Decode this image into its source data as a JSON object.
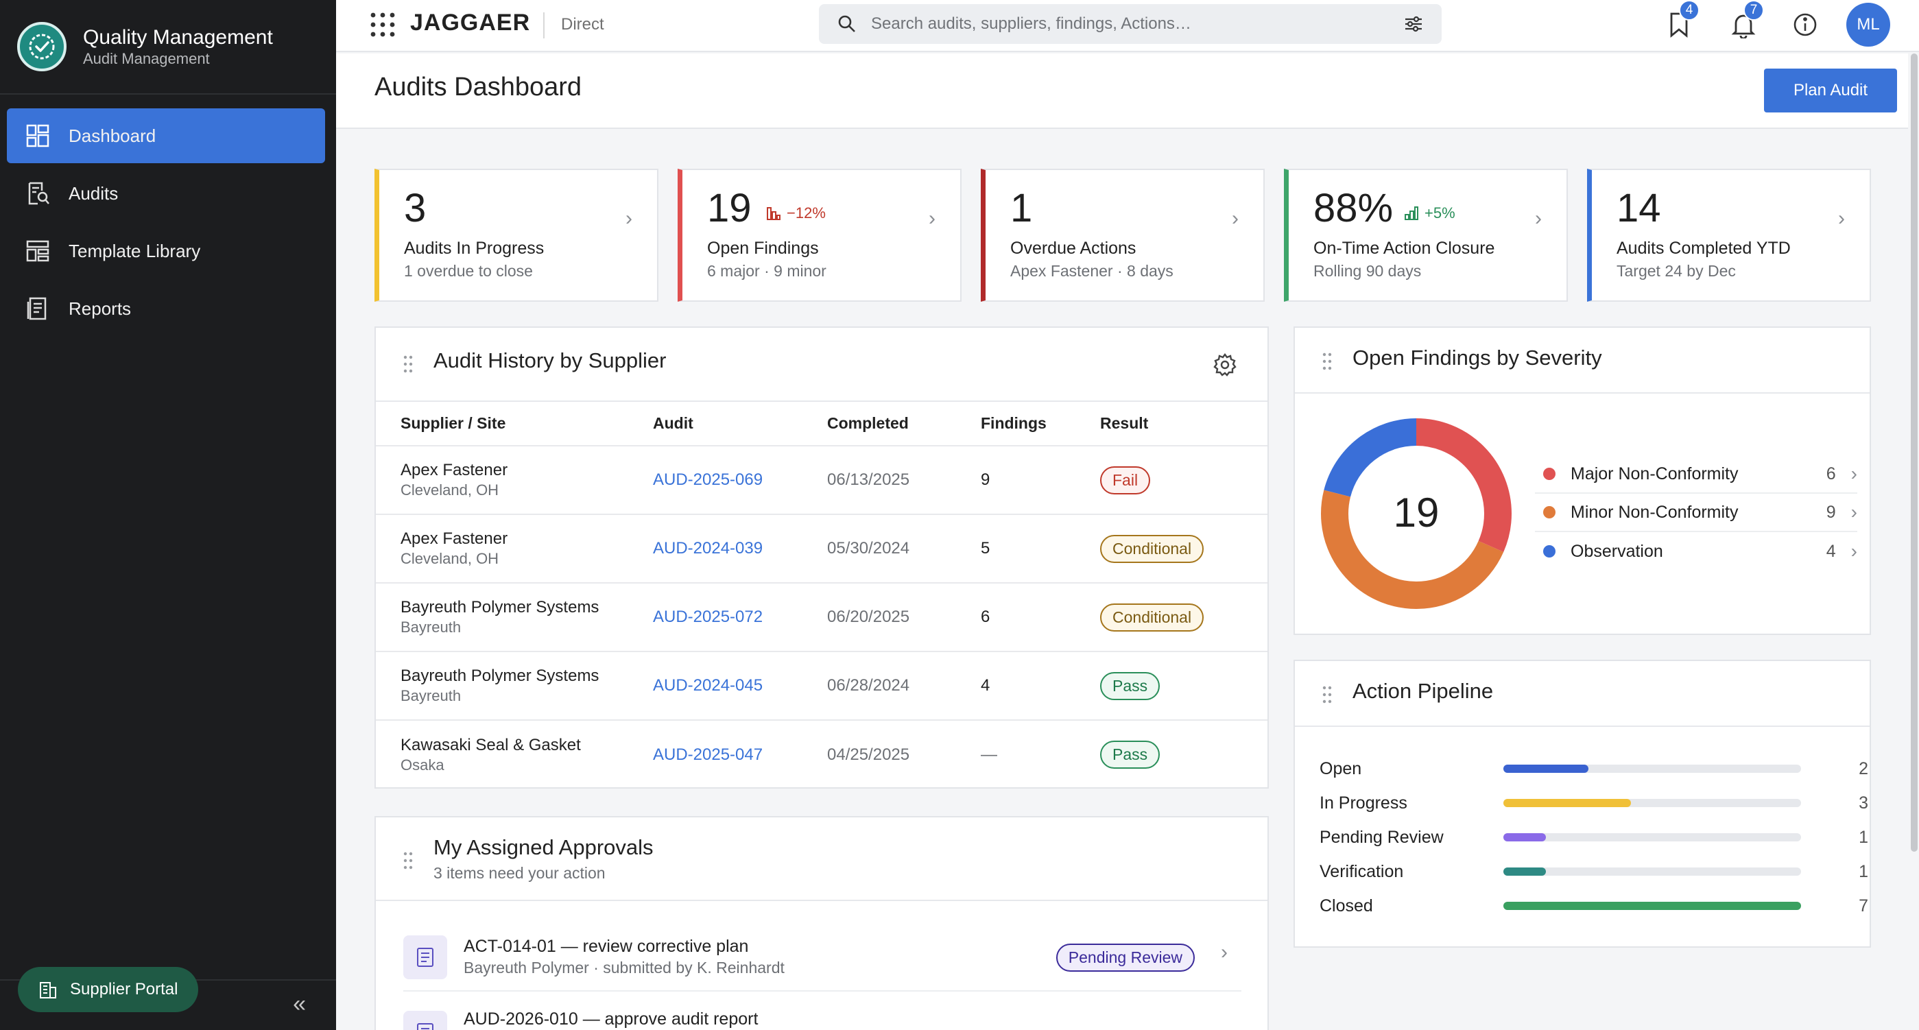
{
  "app": {
    "title": "Quality Management",
    "subtitle": "Audit Management"
  },
  "sidebar": {
    "items": [
      {
        "label": "Dashboard",
        "icon": "dashboard-icon",
        "active": true
      },
      {
        "label": "Audits",
        "icon": "audit-search-icon"
      },
      {
        "label": "Template Library",
        "icon": "template-icon"
      },
      {
        "label": "Reports",
        "icon": "report-icon"
      }
    ],
    "portal_label": "Supplier Portal",
    "collapse_icon": "double-chevron-left-icon"
  },
  "topbar": {
    "logo": "JAGGAER",
    "product": "Direct",
    "search_placeholder": "Search audits, suppliers, findings, Actions…",
    "bookmark_badge": "4",
    "notification_badge": "7",
    "avatar": "ML"
  },
  "page": {
    "title": "Audits Dashboard",
    "plan_button": "Plan Audit"
  },
  "kpis": [
    {
      "value": "3",
      "label": "Audits In Progress",
      "sub": "1 overdue to close",
      "color": "#f2c230"
    },
    {
      "value": "19",
      "delta": "−12%",
      "label": "Open Findings",
      "sub": "6 major · 9 minor",
      "color": "#e05050"
    },
    {
      "value": "1",
      "label": "Overdue Actions",
      "sub": "Apex Fastener · 8 days",
      "color": "#b02a2a"
    },
    {
      "value": "88%",
      "delta": "+5%",
      "label": "On-Time Action Closure",
      "sub": "Rolling 90 days",
      "color": "#3ea56a"
    },
    {
      "value": "14",
      "label": "Audits Completed YTD",
      "sub": "Target 24 by Dec",
      "color": "#3a73d8"
    }
  ],
  "history": {
    "title": "Audit History by Supplier",
    "columns": [
      "Supplier / Site",
      "Audit",
      "Completed",
      "Findings",
      "Result"
    ],
    "rows": [
      {
        "supplier": "Apex Fastener",
        "site": "Cleveland, OH",
        "audit": "AUD-2025-069",
        "completed": "06/13/2025",
        "findings": "9",
        "result": "Fail"
      },
      {
        "supplier": "Apex Fastener",
        "site": "Cleveland, OH",
        "audit": "AUD-2024-039",
        "completed": "05/30/2024",
        "findings": "5",
        "result": "Conditional"
      },
      {
        "supplier": "Bayreuth Polymer Systems",
        "site": "Bayreuth",
        "audit": "AUD-2025-072",
        "completed": "06/20/2025",
        "findings": "6",
        "result": "Conditional"
      },
      {
        "supplier": "Bayreuth Polymer Systems",
        "site": "Bayreuth",
        "audit": "AUD-2024-045",
        "completed": "06/28/2024",
        "findings": "4",
        "result": "Pass"
      },
      {
        "supplier": "Kawasaki Seal & Gasket",
        "site": "Osaka",
        "audit": "AUD-2025-047",
        "completed": "04/25/2025",
        "findings": "—",
        "result": "Pass"
      }
    ]
  },
  "severity": {
    "title": "Open Findings by Severity",
    "total": "19",
    "items": [
      {
        "label": "Major Non-Conformity",
        "count": 6,
        "color": "#e05252"
      },
      {
        "label": "Minor Non-Conformity",
        "count": 9,
        "color": "#e07b3a"
      },
      {
        "label": "Observation",
        "count": 4,
        "color": "#3a6fd8"
      }
    ]
  },
  "pipeline": {
    "title": "Action Pipeline",
    "max": 7,
    "items": [
      {
        "label": "Open",
        "count": 2,
        "color": "#3a62d0"
      },
      {
        "label": "In Progress",
        "count": 3,
        "color": "#f0c038"
      },
      {
        "label": "Pending Review",
        "count": 1,
        "color": "#8a6ae8"
      },
      {
        "label": "Verification",
        "count": 1,
        "color": "#2e8a84"
      },
      {
        "label": "Closed",
        "count": 7,
        "color": "#3aa060"
      }
    ]
  },
  "approvals": {
    "title": "My Assigned Approvals",
    "subtitle": "3 items need your action",
    "items": [
      {
        "title": "ACT-014-01 — review corrective plan",
        "sub": "Bayreuth Polymer · submitted by K. Reinhardt",
        "status": "Pending Review"
      },
      {
        "title": "AUD-2026-010 — approve audit report",
        "sub": "",
        "status": ""
      }
    ]
  }
}
